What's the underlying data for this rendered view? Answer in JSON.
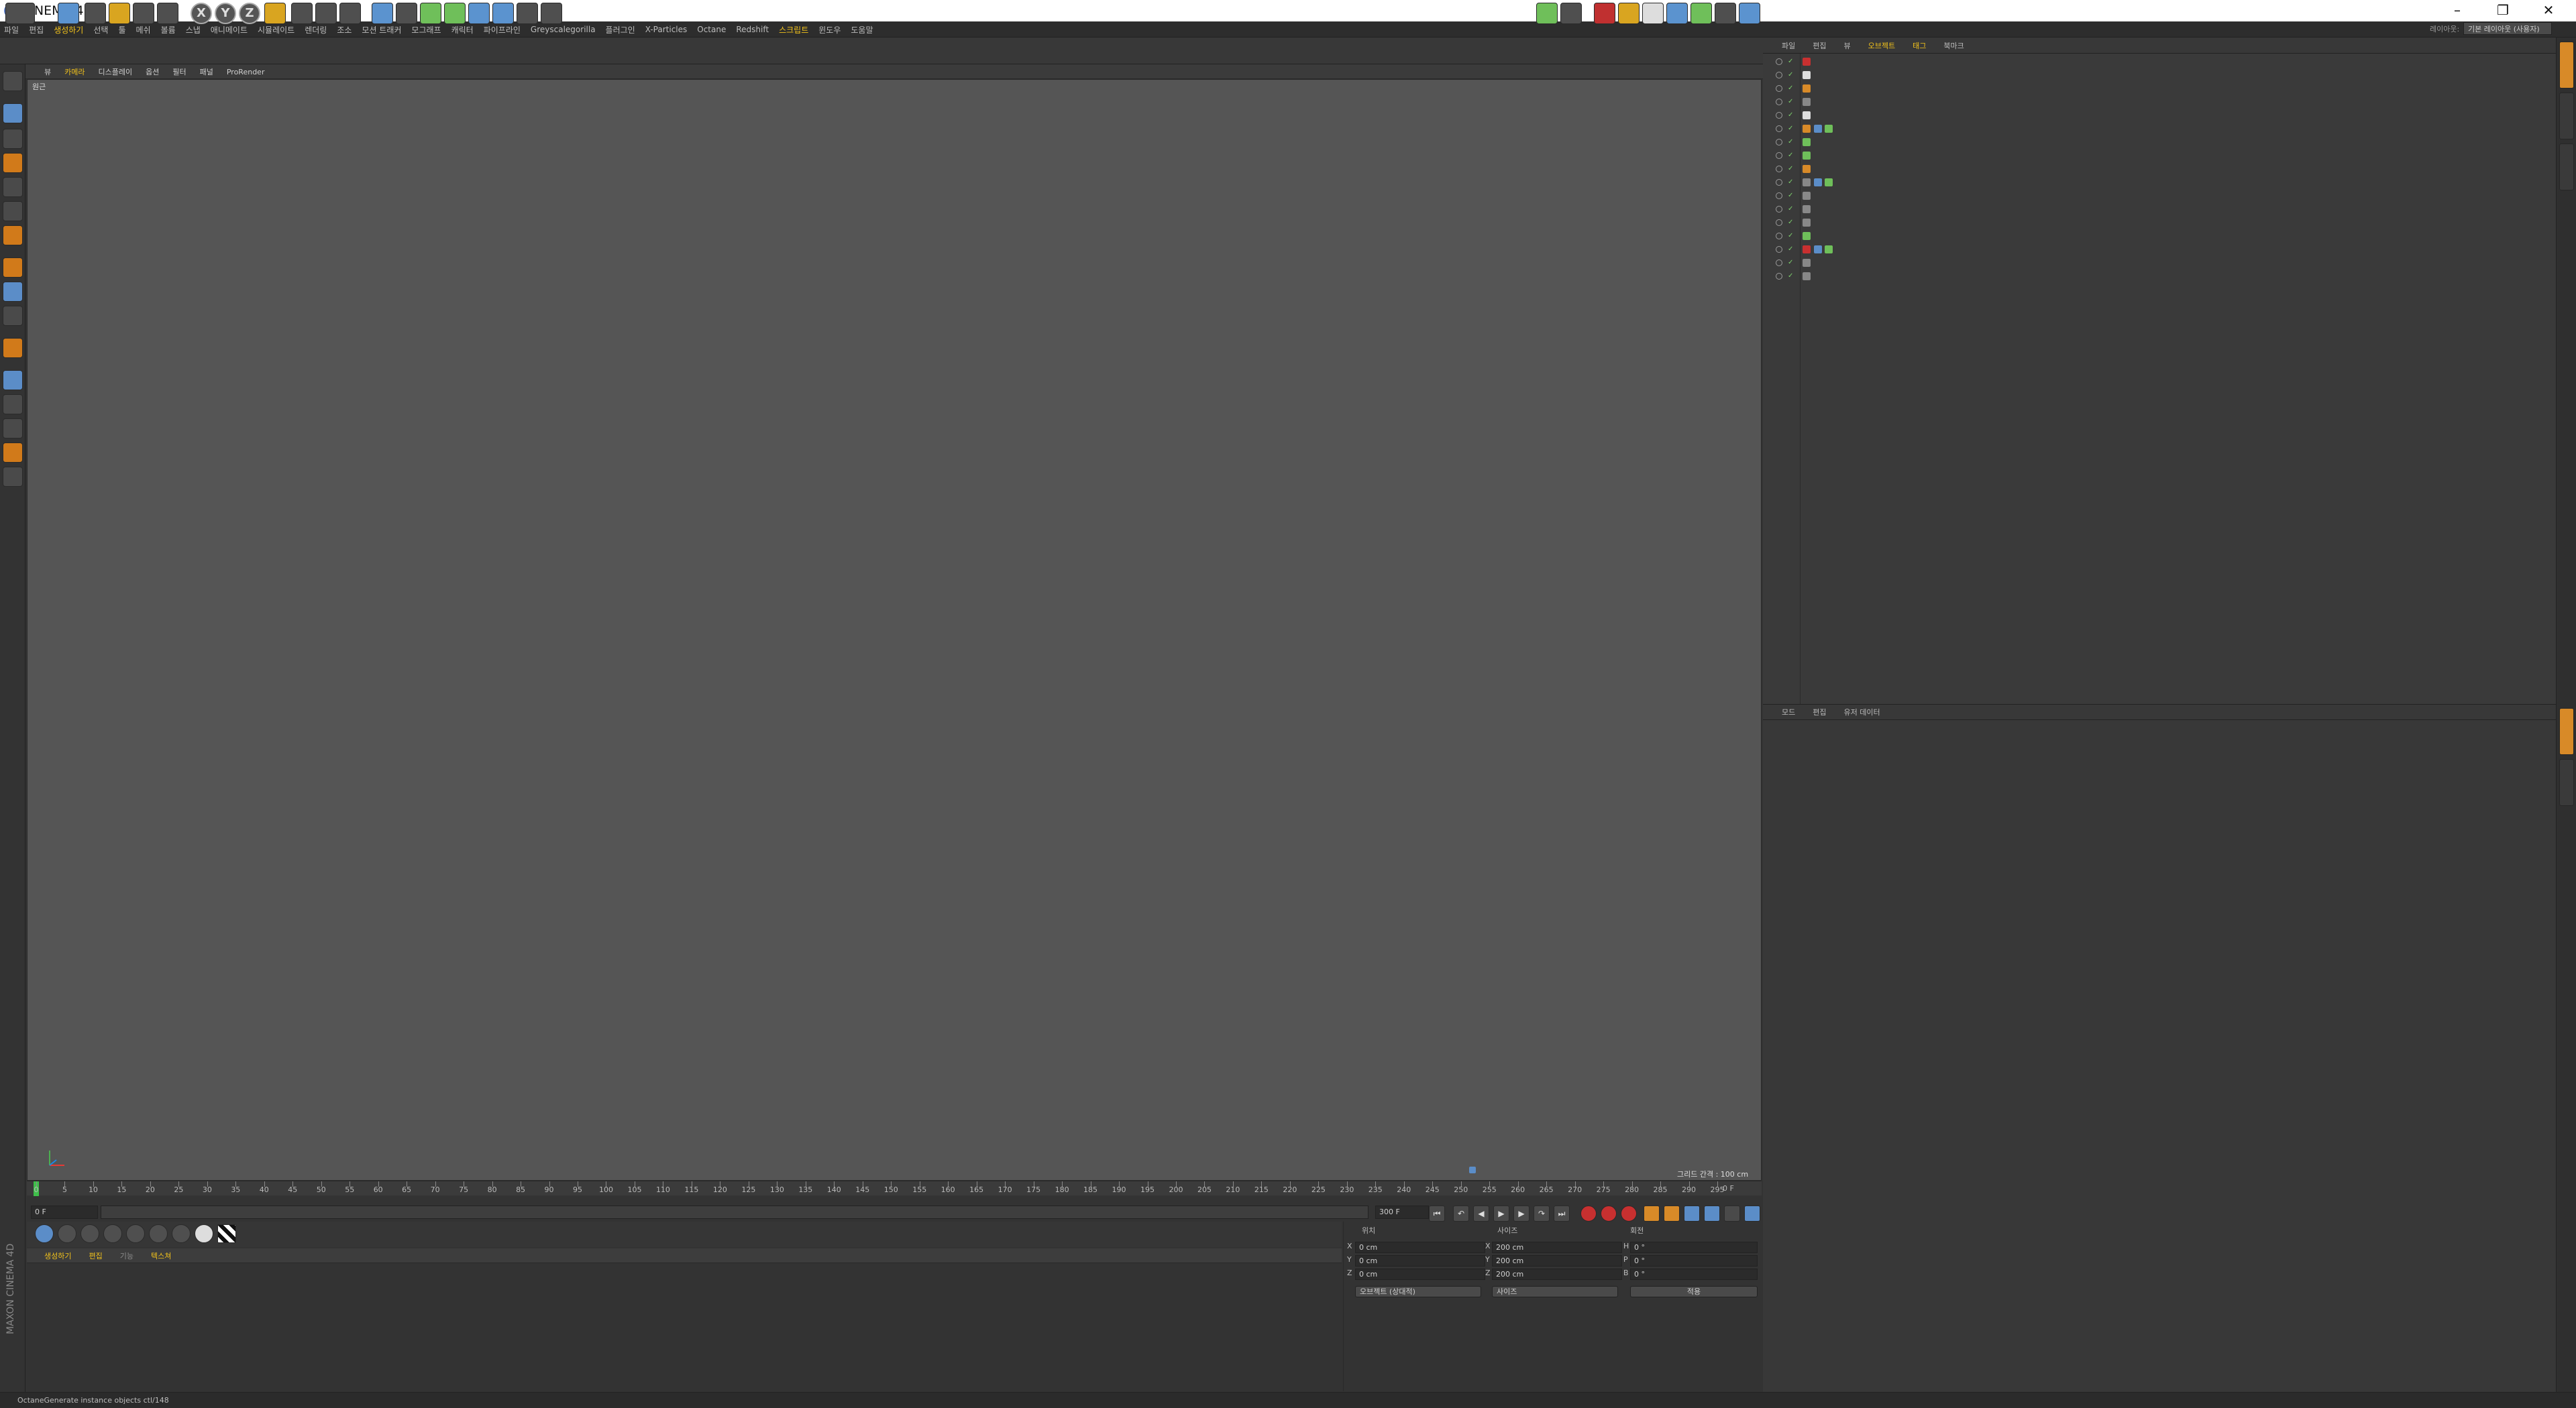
{
  "window": {
    "title": "CINEMA 4D"
  },
  "menubar": {
    "items": [
      "파일",
      "편집",
      "생성하기",
      "선택",
      "툴",
      "메쉬",
      "볼륨",
      "스냅",
      "애니메이트",
      "시뮬레이트",
      "렌더링",
      "조소",
      "모션 트래커",
      "모그래프",
      "캐릭터",
      "파이프라인",
      "Greyscalegorilla",
      "플러그인",
      "X-Particles",
      "Octane",
      "Redshift",
      "스크립트",
      "윈도우",
      "도움말"
    ],
    "highlighted": [
      "생성하기",
      "스크립트"
    ],
    "layout_label": "레이아웃:",
    "layout_value": "기본 레이아웃 (사용자)"
  },
  "viewport": {
    "menu": [
      "뷰",
      "카메라",
      "디스플레이",
      "옵션",
      "필터",
      "패널",
      "ProRender"
    ],
    "active_menu": "카메라",
    "label": "원근",
    "grid_text": "그리드 간격 : 100 cm"
  },
  "timeline": {
    "ticks": [
      "0",
      "5",
      "10",
      "15",
      "20",
      "25",
      "30",
      "35",
      "40",
      "45",
      "50",
      "55",
      "60",
      "65",
      "70",
      "75",
      "80",
      "85",
      "90",
      "95",
      "100",
      "105",
      "110",
      "115",
      "120",
      "125",
      "130",
      "135",
      "140",
      "145",
      "150",
      "155",
      "160",
      "165",
      "170",
      "175",
      "180",
      "185",
      "190",
      "195",
      "200",
      "205",
      "210",
      "215",
      "220",
      "225",
      "230",
      "235",
      "240",
      "245",
      "250",
      "255",
      "260",
      "265",
      "270",
      "275",
      "280",
      "285",
      "290",
      "295"
    ],
    "end_label": "0 F",
    "current_frame": "0 F",
    "start_field": "0 F",
    "end_field": "300 F",
    "current_field": "0 F"
  },
  "materials": {
    "menu": [
      "생성하기",
      "편집",
      "기능",
      "텍스쳐"
    ],
    "dim_items": [
      "기능"
    ]
  },
  "coordinates": {
    "headers": {
      "position": "위치",
      "size": "사이즈",
      "rotation": "회전"
    },
    "rows": [
      {
        "axis": "X",
        "position": "0 cm",
        "size": "200 cm",
        "rot_axis": "H",
        "rotation": "0 °"
      },
      {
        "axis": "Y",
        "position": "0 cm",
        "size": "200 cm",
        "rot_axis": "P",
        "rotation": "0 °"
      },
      {
        "axis": "Z",
        "position": "0 cm",
        "size": "200 cm",
        "rot_axis": "B",
        "rotation": "0 °"
      }
    ],
    "mode_select": "오브젝트 (상대적)",
    "size_select": "사이즈",
    "apply_button": "적용"
  },
  "object_manager": {
    "menu": [
      "파일",
      "편집",
      "뷰",
      "오브젝트",
      "태그",
      "북마크"
    ],
    "highlighted": [
      "오브젝트",
      "태그"
    ],
    "rows": 17
  },
  "attributes": {
    "menu": [
      "모드",
      "편집",
      "유저 데이터"
    ]
  },
  "status": {
    "text": "OctaneGenerate instance objects ctl/148"
  },
  "branding": {
    "maxon": "MAXON CINEMA 4D"
  }
}
